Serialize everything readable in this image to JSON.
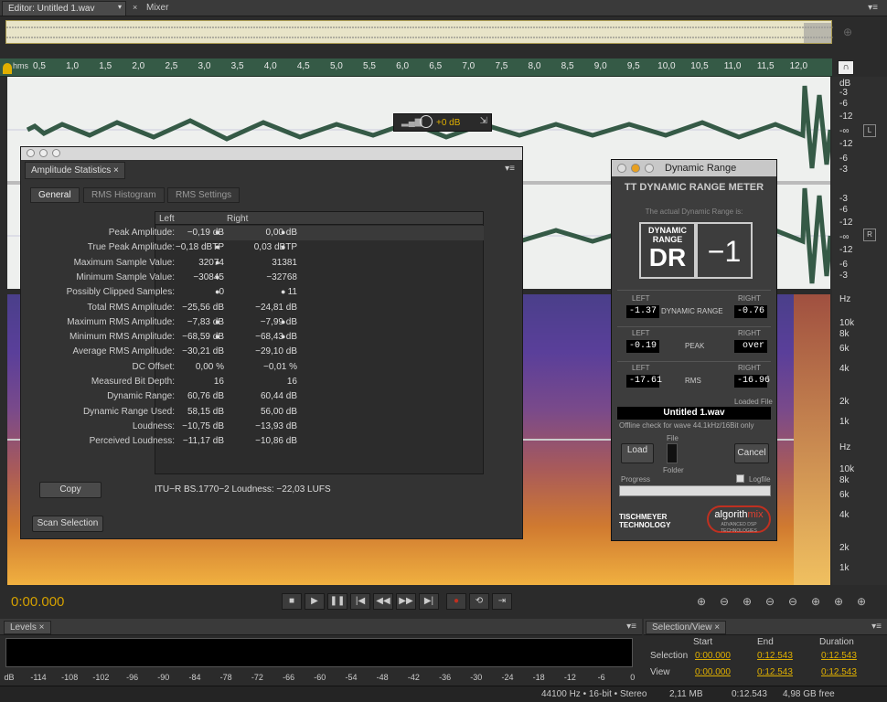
{
  "tabs": {
    "editor": "Editor: Untitled 1.wav",
    "mixer": "Mixer"
  },
  "ruler": {
    "unit": "hms",
    "ticks": [
      "0,5",
      "1,0",
      "1,5",
      "2,0",
      "2,5",
      "3,0",
      "3,5",
      "4,0",
      "4,5",
      "5,0",
      "5,5",
      "6,0",
      "6,5",
      "7,0",
      "7,5",
      "8,0",
      "8,5",
      "9,0",
      "9,5",
      "10,0",
      "10,5",
      "11,0",
      "11,5",
      "12,0"
    ]
  },
  "hud": {
    "value": "+0 dB"
  },
  "db_scale": {
    "unit": "dB",
    "top_labels": [
      "-3",
      "-6",
      "-12",
      "-∞",
      "-12",
      "-6",
      "-3"
    ],
    "bottom_labels": [
      "-3",
      "-6",
      "-12",
      "-∞",
      "-12",
      "-6",
      "-3"
    ],
    "left_channel": "L",
    "right_channel": "R",
    "freq_unit": "Hz",
    "freq_labels": [
      "10k",
      "8k",
      "6k",
      "4k",
      "2k",
      "1k"
    ],
    "freq_labels2": [
      "10k",
      "8k",
      "6k",
      "4k",
      "2k",
      "1k"
    ]
  },
  "amplitude": {
    "title": "Amplitude Statistics",
    "tabs": [
      "General",
      "RMS Histogram",
      "RMS Settings"
    ],
    "col_left": "Left",
    "col_right": "Right",
    "rows": [
      {
        "label": "Peak Amplitude:",
        "left": "−0,19 dB",
        "right": "0,00 dB"
      },
      {
        "label": "True Peak Amplitude:",
        "left": "−0,18 dBTP",
        "right": "0,03 dBTP"
      },
      {
        "label": "Maximum Sample Value:",
        "left": "32074",
        "right": "31381"
      },
      {
        "label": "Minimum Sample Value:",
        "left": "−30845",
        "right": "−32768"
      },
      {
        "label": "Possibly Clipped Samples:",
        "left": "0",
        "right": "11"
      },
      {
        "label": "Total RMS Amplitude:",
        "left": "−25,56 dB",
        "right": "−24,81 dB"
      },
      {
        "label": "Maximum RMS Amplitude:",
        "left": "−7,83 dB",
        "right": "−7,99 dB"
      },
      {
        "label": "Minimum RMS Amplitude:",
        "left": "−68,59 dB",
        "right": "−68,43 dB"
      },
      {
        "label": "Average RMS Amplitude:",
        "left": "−30,21 dB",
        "right": "−29,10 dB"
      },
      {
        "label": "DC Offset:",
        "left": "0,00 %",
        "right": "−0,01 %"
      },
      {
        "label": "Measured Bit Depth:",
        "left": "16",
        "right": "16"
      },
      {
        "label": "Dynamic Range:",
        "left": "60,76 dB",
        "right": "60,44 dB"
      },
      {
        "label": "Dynamic Range Used:",
        "left": "58,15 dB",
        "right": "56,00 dB"
      },
      {
        "label": "Loudness:",
        "left": "−10,75 dB",
        "right": "−13,93 dB"
      },
      {
        "label": "Perceived Loudness:",
        "left": "−11,17 dB",
        "right": "−10,86 dB"
      }
    ],
    "copy": "Copy",
    "itu": "ITU−R BS.1770−2 Loudness: −22,03 LUFS",
    "scan": "Scan Selection"
  },
  "dr": {
    "window_title": "Dynamic Range",
    "header": "TT DYNAMIC RANGE METER",
    "subtitle": "The actual Dynamic Range is:",
    "logo_line1": "DYNAMIC",
    "logo_line2": "RANGE",
    "logo_big": "DR",
    "value": "−1",
    "left": "LEFT",
    "right": "RIGHT",
    "dr_label": "DYNAMIC RANGE",
    "dr_left": "-1.37",
    "dr_right": "-0.76",
    "peak_label": "PEAK",
    "peak_left": "-0.19",
    "peak_right": "over",
    "rms_label": "RMS",
    "rms_left": "-17.61",
    "rms_right": "-16.96",
    "loaded_file_label": "Loaded File",
    "filename": "Untitled 1.wav",
    "offline": "Offline check for wave 44.1kHz/16Bit only",
    "load": "Load",
    "file": "File",
    "folder": "Folder",
    "cancel": "Cancel",
    "progress": "Progress",
    "logfile": "Logfile",
    "brand1_line1": "TISCHMEYER",
    "brand1_line2": "TECHNOLOGY",
    "brand2a": "algorith",
    "brand2b": "mix",
    "brand2_sub": "ADVANCED DSP TECHNOLOGIES"
  },
  "transport": {
    "time": "0:00.000"
  },
  "levels": {
    "title": "Levels",
    "ticks": [
      "dB",
      "-114",
      "-108",
      "-102",
      "-96",
      "-90",
      "-84",
      "-78",
      "-72",
      "-66",
      "-60",
      "-54",
      "-48",
      "-42",
      "-36",
      "-30",
      "-24",
      "-18",
      "-12",
      "-6",
      "0"
    ]
  },
  "selview": {
    "title": "Selection/View",
    "start": "Start",
    "end": "End",
    "duration": "Duration",
    "selection": "Selection",
    "view": "View",
    "sel_start": "0:00.000",
    "sel_end": "0:12.543",
    "sel_dur": "0:12.543",
    "view_start": "0:00.000",
    "view_end": "0:12.543",
    "view_dur": "0:12.543"
  },
  "status": {
    "format": "44100 Hz • 16-bit • Stereo",
    "size": "2,11 MB",
    "duration": "0:12.543",
    "free": "4,98 GB free"
  }
}
